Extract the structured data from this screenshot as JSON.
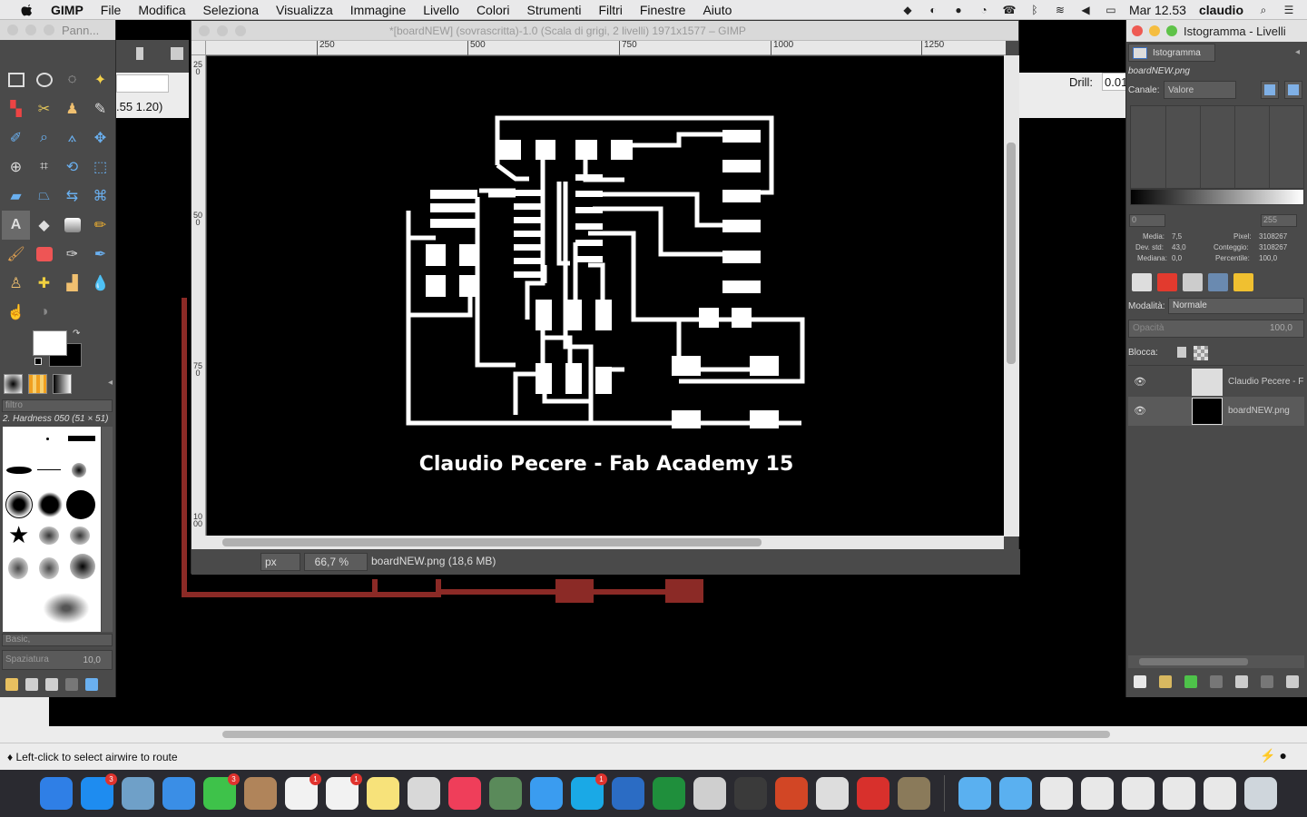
{
  "menubar": {
    "app": "GIMP",
    "items": [
      "File",
      "Modifica",
      "Seleziona",
      "Visualizza",
      "Immagine",
      "Livello",
      "Colori",
      "Strumenti",
      "Filtri",
      "Finestre",
      "Aiuto"
    ],
    "clock": "Mar 12.53",
    "user": "claudio"
  },
  "toolbox": {
    "title": "Pann...",
    "filter_placeholder": "filtro",
    "brush_name": "2. Hardness 050 (51 × 51)",
    "brush_preset": "Basic,",
    "spacing_label": "Spaziatura",
    "spacing_value": "10,0"
  },
  "background_app": {
    "drill_label": "Drill:",
    "drill_value": "0.01",
    "coords": ".55 1.20)",
    "status": "♦ Left-click to select airwire to route"
  },
  "image_window": {
    "title": "*[boardNEW] (sovrascritta)-1.0 (Scala di grigi, 2 livelli) 1971x1577 – GIMP",
    "ruler_h": [
      "250",
      "500",
      "750",
      "1000",
      "1250"
    ],
    "ruler_v": [
      "250",
      "500",
      "750",
      "1000"
    ],
    "caption": "Claudio Pecere - Fab Academy 15",
    "unit": "px",
    "zoom": "66,7 %",
    "file_info": "boardNEW.png (18,6 MB)"
  },
  "dock": {
    "title": "Istogramma - Livelli",
    "hist_tab": "Istogramma",
    "hist_file": "boardNEW.png",
    "channel_label": "Canale:",
    "channel_value": "Valore",
    "range_lo": "0",
    "range_hi": "255",
    "stats": {
      "media_label": "Media:",
      "media": "7,5",
      "devstd_label": "Dev. std:",
      "devstd": "43,0",
      "mediana_label": "Mediana:",
      "mediana": "0,0",
      "pixel_label": "Pixel:",
      "pixel": "3108267",
      "conteggio_label": "Conteggio:",
      "conteggio": "3108267",
      "percentile_label": "Percentile:",
      "percentile": "100,0"
    },
    "mode_label": "Modalità:",
    "mode_value": "Normale",
    "opacity_label": "Opacità",
    "opacity_value": "100,0",
    "lock_label": "Blocca:",
    "layers": [
      {
        "name": "Claudio Pecere - F"
      },
      {
        "name": "boardNEW.png"
      }
    ]
  },
  "taskbar": {
    "apps": [
      {
        "name": "finder-icon",
        "color": "#2f7fe6"
      },
      {
        "name": "app-store-icon",
        "color": "#1e8cf0",
        "badge": "3"
      },
      {
        "name": "preview-icon",
        "color": "#6fa0c8"
      },
      {
        "name": "safari-icon",
        "color": "#3a8ee6"
      },
      {
        "name": "facetime-icon",
        "color": "#3ec24a",
        "badge": "3"
      },
      {
        "name": "contacts-icon",
        "color": "#b0845a"
      },
      {
        "name": "calendar-icon",
        "color": "#f2f2f2",
        "badge": "1"
      },
      {
        "name": "reminders-icon",
        "color": "#f2f2f2",
        "badge": "1"
      },
      {
        "name": "notes-icon",
        "color": "#f7e27a"
      },
      {
        "name": "photos-icon",
        "color": "#d8d8d8"
      },
      {
        "name": "itunes-icon",
        "color": "#ef3e5a"
      },
      {
        "name": "photo-booth-icon",
        "color": "#5a8a5a"
      },
      {
        "name": "messages-icon",
        "color": "#3a9cf0"
      },
      {
        "name": "skype-icon",
        "color": "#1aa9e6",
        "badge": "1"
      },
      {
        "name": "word-icon",
        "color": "#2b6cc4"
      },
      {
        "name": "excel-icon",
        "color": "#1f8f3c"
      },
      {
        "name": "inkscape-icon",
        "color": "#cfcfcf"
      },
      {
        "name": "eagle-icon",
        "color": "#3a3a3a"
      },
      {
        "name": "powerpoint-icon",
        "color": "#d24625"
      },
      {
        "name": "fab-modules-icon",
        "color": "#dddddd"
      },
      {
        "name": "bird-icon",
        "color": "#d8302c"
      },
      {
        "name": "gimp-icon",
        "color": "#8a7a5a"
      },
      {
        "name": "downloads-folder-icon",
        "color": "#5ab0f0"
      },
      {
        "name": "documents-folder-icon",
        "color": "#5ab0f0"
      },
      {
        "name": "file-icon-1",
        "color": "#e8e8e8"
      },
      {
        "name": "file-icon-2",
        "color": "#e8e8e8"
      },
      {
        "name": "file-icon-3",
        "color": "#e8e8e8"
      },
      {
        "name": "file-icon-4",
        "color": "#e8e8e8"
      },
      {
        "name": "file-icon-5",
        "color": "#e8e8e8"
      },
      {
        "name": "trash-icon",
        "color": "#cfd6dc"
      }
    ]
  }
}
